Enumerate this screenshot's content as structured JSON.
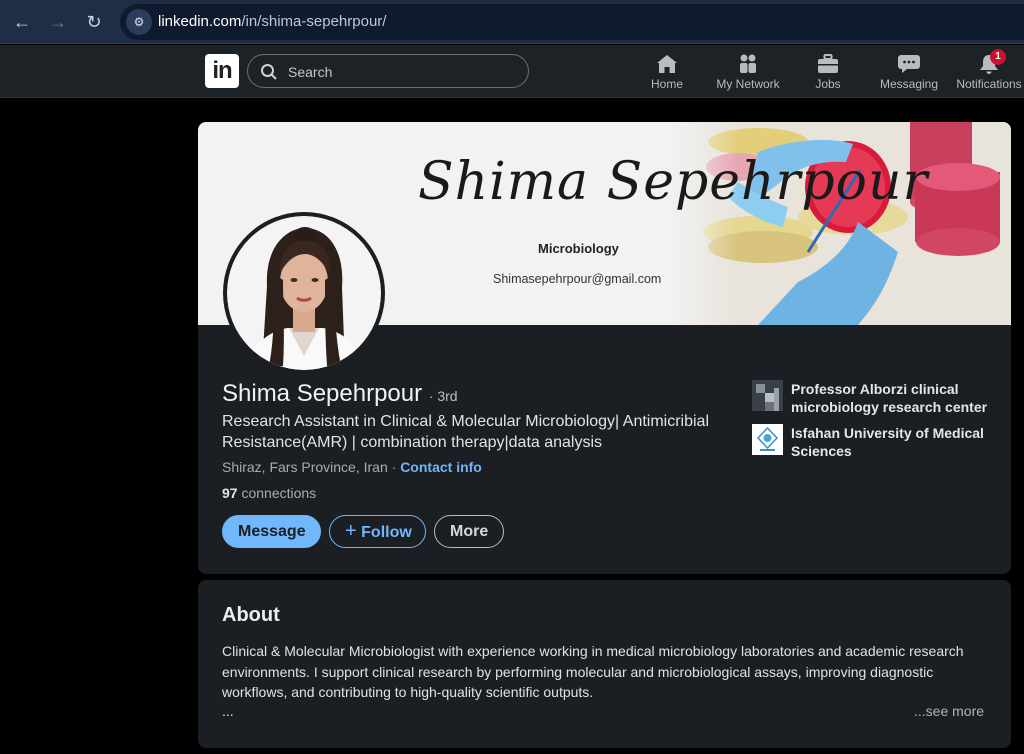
{
  "browser": {
    "url_host": "linkedin.com",
    "url_path": "/in/shima-sepehrpour/"
  },
  "header": {
    "logo": "in",
    "search_placeholder": "Search",
    "nav": [
      {
        "label": "Home",
        "icon": "home-icon"
      },
      {
        "label": "My Network",
        "icon": "network-icon"
      },
      {
        "label": "Jobs",
        "icon": "briefcase-icon"
      },
      {
        "label": "Messaging",
        "icon": "chat-icon"
      },
      {
        "label": "Notifications",
        "icon": "bell-icon",
        "badge": "1"
      }
    ]
  },
  "banner": {
    "signature": "Shima Sepehrpour",
    "subtitle": "Microbiology",
    "email": "Shimasepehrpour@gmail.com"
  },
  "profile": {
    "name": "Shima Sepehrpour",
    "degree": "· 3rd",
    "headline": "Research Assistant in Clinical & Molecular Microbiology| Antimicribial Resistance(AMR) | combination therapy|data analysis",
    "location": "Shiraz, Fars Province, Iran",
    "separator": "·",
    "contact_info": "Contact info",
    "connections_count": "97",
    "connections_label": "connections",
    "buttons": {
      "message": "Message",
      "follow": "Follow",
      "more": "More"
    },
    "organizations": [
      {
        "name": "Professor Alborzi clinical microbiology research center"
      },
      {
        "name": "Isfahan University of Medical Sciences"
      }
    ]
  },
  "about": {
    "title": "About",
    "text": "Clinical & Molecular Microbiologist with experience working in medical microbiology laboratories and academic research environments. I support clinical research by performing molecular and microbiological assays, improving diagnostic workflows, and contributing to high-quality scientific outputs.",
    "ellipsis": "...",
    "see_more": "...see more"
  },
  "colors": {
    "accent": "#71b7fb",
    "badge": "#cb112d",
    "card_bg": "#1b1f23"
  }
}
